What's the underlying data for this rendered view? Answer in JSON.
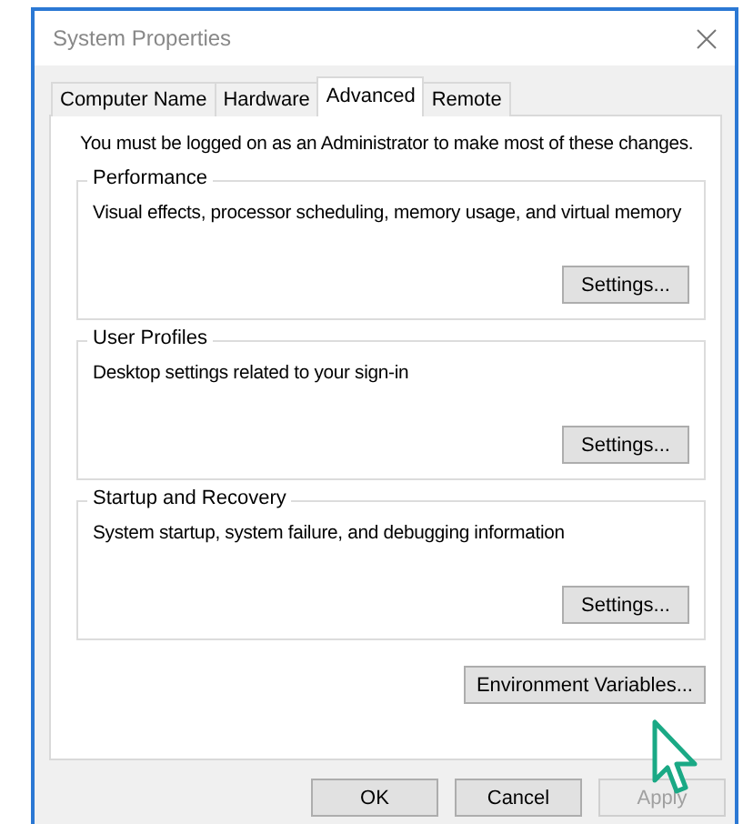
{
  "window": {
    "title": "System Properties"
  },
  "tabs": [
    {
      "label": "Computer Name",
      "selected": false
    },
    {
      "label": "Hardware",
      "selected": false
    },
    {
      "label": "Advanced",
      "selected": true
    },
    {
      "label": "Remote",
      "selected": false
    }
  ],
  "notice": "You must be logged on as an Administrator to make most of these changes.",
  "groups": [
    {
      "title": "Performance",
      "description": "Visual effects, processor scheduling, memory usage, and virtual memory",
      "button": "Settings..."
    },
    {
      "title": "User Profiles",
      "description": "Desktop settings related to your sign-in",
      "button": "Settings..."
    },
    {
      "title": "Startup and Recovery",
      "description": "System startup, system failure, and debugging information",
      "button": "Settings..."
    }
  ],
  "environment_button": "Environment Variables...",
  "buttons": [
    {
      "label": "OK",
      "disabled": false
    },
    {
      "label": "Cancel",
      "disabled": false
    },
    {
      "label": "Apply",
      "disabled": true
    }
  ]
}
